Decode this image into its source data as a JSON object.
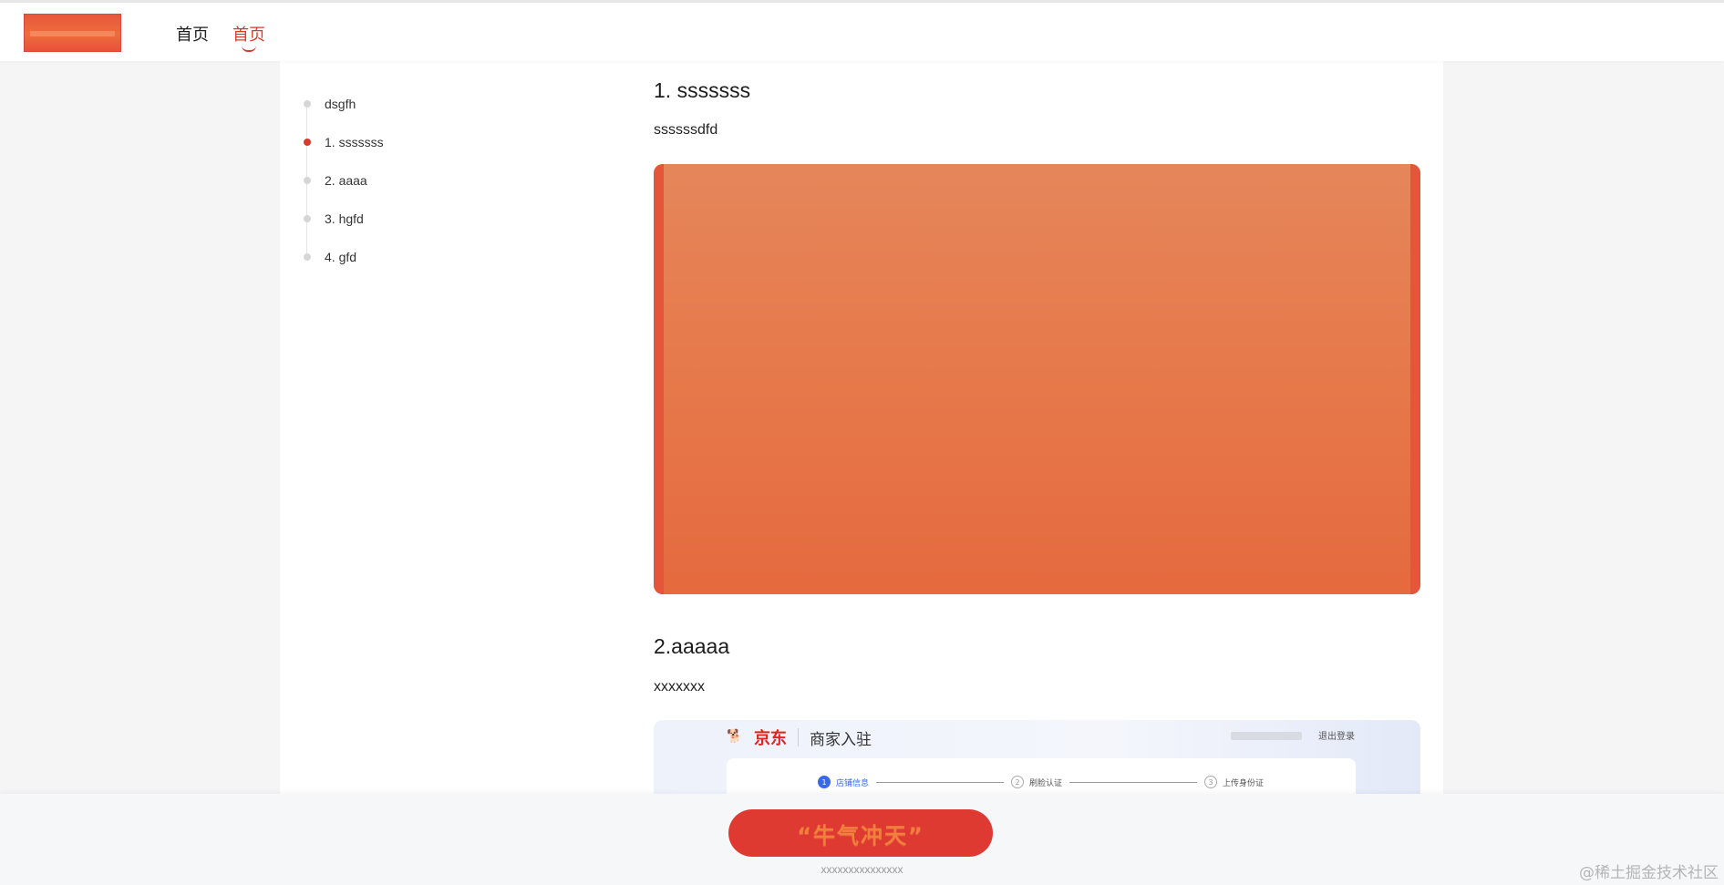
{
  "header": {
    "logo_icon": "brand-logo-image",
    "nav": [
      {
        "label": "首页",
        "active": false
      },
      {
        "label": "首页",
        "active": true
      }
    ]
  },
  "toc": {
    "items": [
      {
        "label": "dsgfh",
        "active": false
      },
      {
        "label": "1. sssssss",
        "active": true
      },
      {
        "label": "2. aaaa",
        "active": false
      },
      {
        "label": "3. hgfd",
        "active": false
      },
      {
        "label": "4. gfd",
        "active": false
      }
    ]
  },
  "article": {
    "sections": [
      {
        "heading": "1. sssssss",
        "text": "ssssssdfd",
        "image": "orange-banner-image"
      },
      {
        "heading": "2.aaaaa",
        "text": "xxxxxxx",
        "image": "jd-merchant-screenshot"
      }
    ],
    "jd_image": {
      "brand": "京东",
      "title": "商家入驻",
      "logout": "退出登录",
      "steps": [
        {
          "num": "1",
          "label": "店铺信息",
          "active": true
        },
        {
          "num": "2",
          "label": "刷脸认证",
          "active": false
        },
        {
          "num": "3",
          "label": "上传身份证",
          "active": false
        }
      ]
    }
  },
  "footer": {
    "cta_label": "“牛气冲天”",
    "note": "xxxxxxxxxxxxxxx",
    "watermark": "@稀土掘金技术社区"
  },
  "colors": {
    "accent": "#d93b2b",
    "cta": "#df3a31",
    "banner": "#e67a4c",
    "jd_red": "#e1251b",
    "step_blue": "#3769ea"
  }
}
